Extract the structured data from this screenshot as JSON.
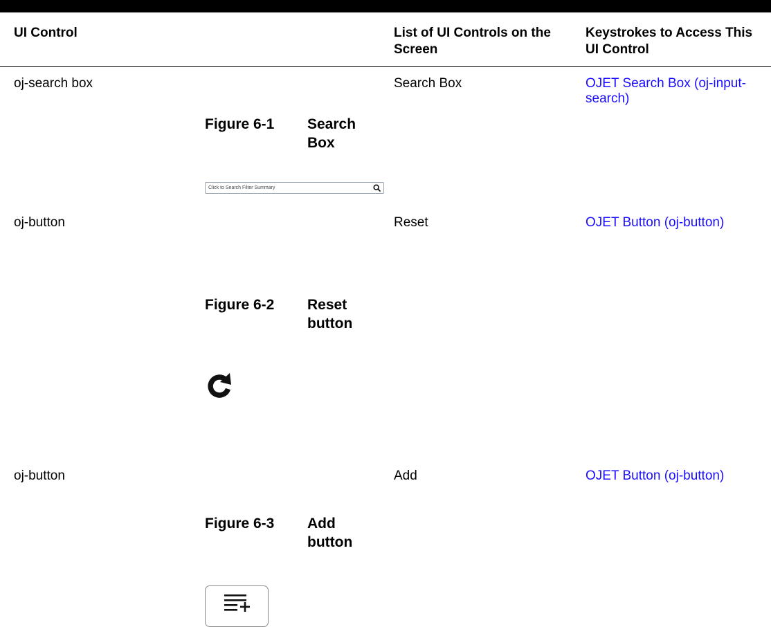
{
  "table": {
    "headers": {
      "ui_control": "UI Control",
      "list_controls": "List of UI Controls on the Screen",
      "keystrokes": "Keystrokes to Access This UI Control"
    },
    "rows": [
      {
        "control": "oj-search box",
        "list_item": "Search Box",
        "link": "OJET Search Box (oj-input-search)",
        "figure_number": "Figure 6-1",
        "figure_title": "Search Box",
        "image": {
          "placeholder": "Click to Search Filter Summary",
          "icon": "search-icon"
        }
      },
      {
        "control": "oj-button",
        "list_item": "Reset",
        "link": "OJET Button (oj-button)",
        "figure_number": "Figure 6-2",
        "figure_title": "Reset button",
        "image": {
          "icon": "reset-icon"
        }
      },
      {
        "control": "oj-button",
        "list_item": "Add",
        "link": "OJET Button (oj-button)",
        "figure_number": "Figure 6-3",
        "figure_title": "Add button",
        "image": {
          "icon": "add-list-icon"
        }
      }
    ]
  },
  "colors": {
    "link": "#1a0dff",
    "rule": "#000000"
  }
}
